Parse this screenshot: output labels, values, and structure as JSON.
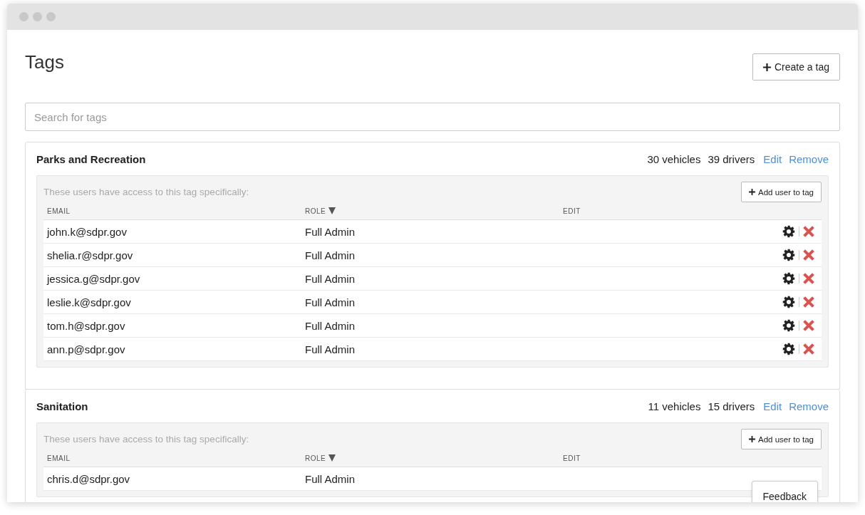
{
  "page": {
    "title": "Tags",
    "create_button": "Create a tag",
    "search": {
      "placeholder": "Search for tags"
    }
  },
  "sections": [
    {
      "name": "Parks and Recreation",
      "vehicles": "30 vehicles",
      "drivers": "39 drivers",
      "edit": "Edit",
      "remove": "Remove",
      "note": "These users have access to this tag specifically:",
      "add_button": "Add user to tag",
      "columns": [
        {
          "label": "EMAIL"
        },
        {
          "label": "ROLE",
          "sorted": true
        },
        {
          "label": "EDIT"
        }
      ],
      "users": [
        {
          "email": "john.k@sdpr.gov",
          "role": "Full Admin",
          "actions": true
        },
        {
          "email": "shelia.r@sdpr.gov",
          "role": "Full Admin",
          "actions": true
        },
        {
          "email": "jessica.g@sdpr.gov",
          "role": "Full Admin",
          "actions": true
        },
        {
          "email": "leslie.k@sdpr.gov",
          "role": "Full Admin",
          "actions": true
        },
        {
          "email": "tom.h@sdpr.gov",
          "role": "Full Admin",
          "actions": true
        },
        {
          "email": "ann.p@sdpr.gov",
          "role": "Full Admin",
          "actions": true
        }
      ]
    },
    {
      "name": "Sanitation",
      "vehicles": "11 vehicles",
      "drivers": "15 drivers",
      "edit": "Edit",
      "remove": "Remove",
      "note": "These users have access to this tag specifically:",
      "add_button": "Add user to tag",
      "columns": [
        {
          "label": "EMAIL"
        },
        {
          "label": "ROLE",
          "sorted": true
        },
        {
          "label": "EDIT"
        }
      ],
      "users": [
        {
          "email": "chris.d@sdpr.gov",
          "role": "Full Admin",
          "actions": false
        }
      ]
    }
  ],
  "feedback_button": "Feedback"
}
